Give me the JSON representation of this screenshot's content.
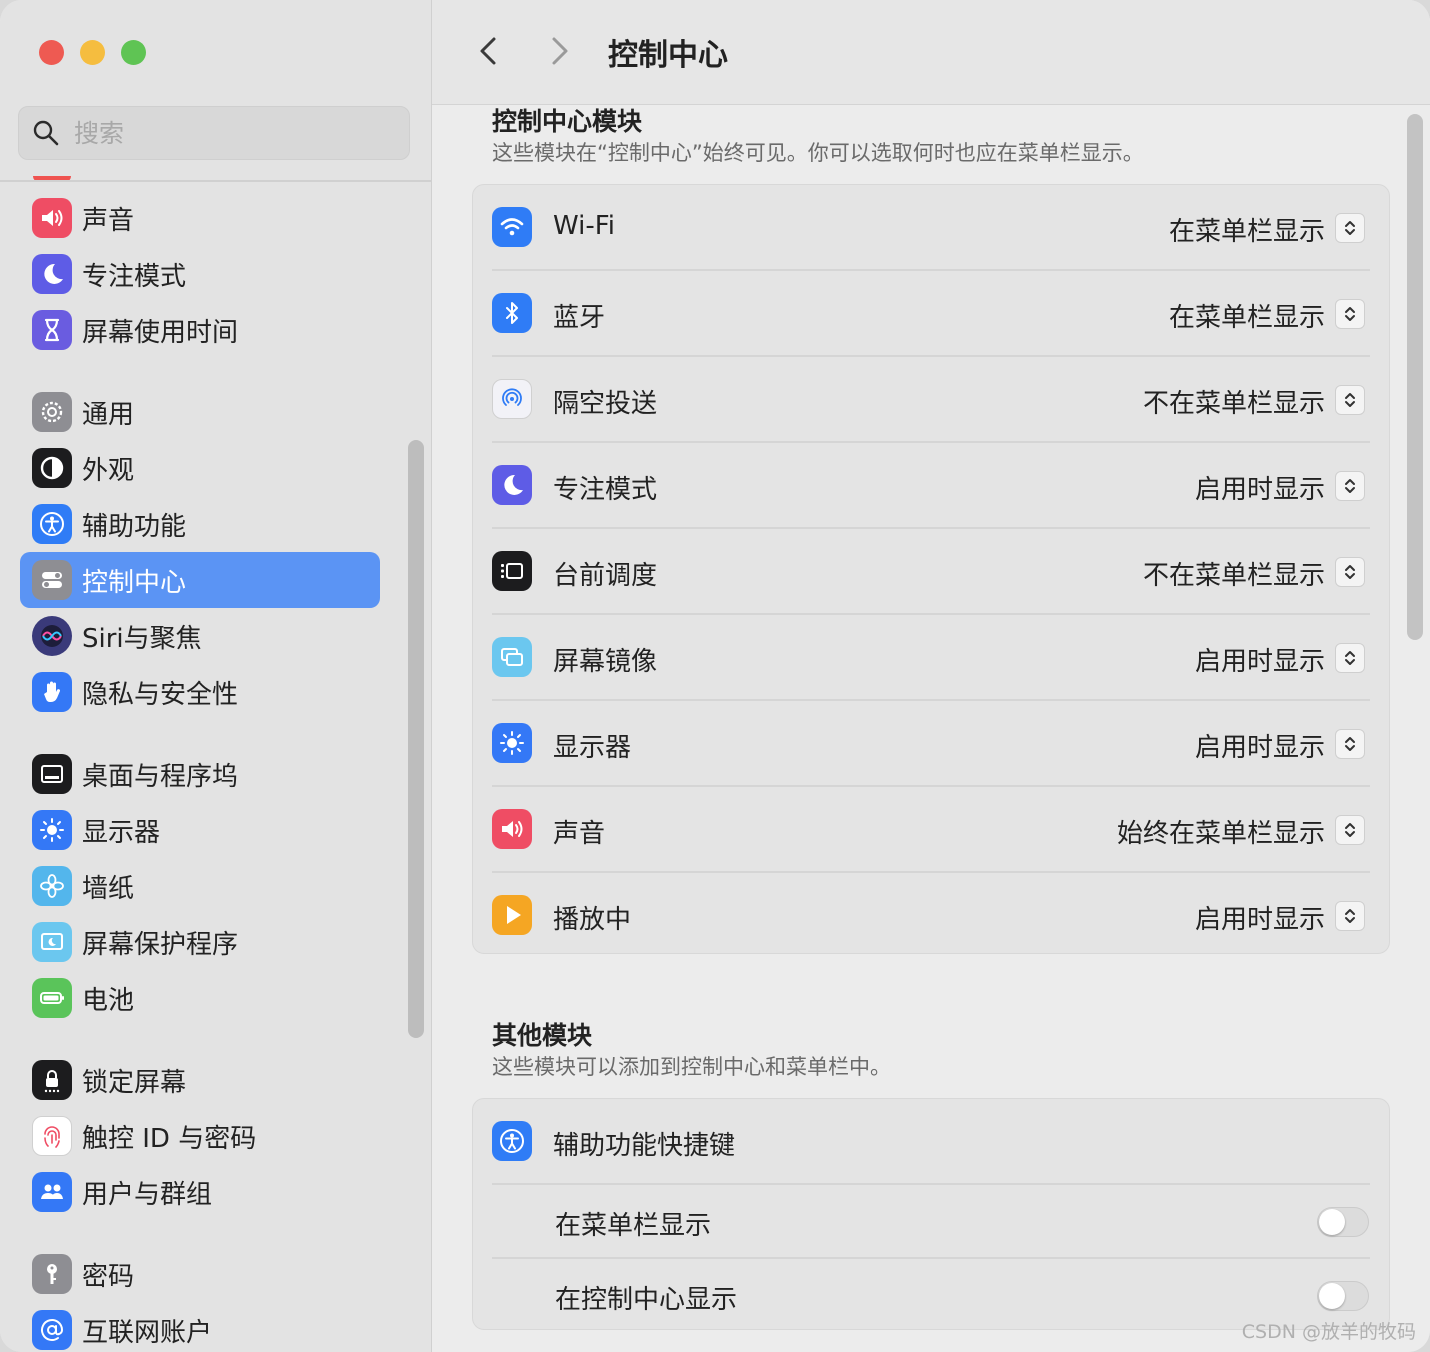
{
  "window": {
    "traffic_lights": {
      "close": "#ee5a52",
      "minimize": "#f5bd3f",
      "zoom": "#5fc454"
    }
  },
  "sidebar": {
    "search_placeholder": "搜索",
    "selected_color": "#5b94f4",
    "items": [
      {
        "label": "声音",
        "icon": "speaker-icon",
        "color": "#ef4d64"
      },
      {
        "label": "专注模式",
        "icon": "moon-icon",
        "color": "#5e5ce6"
      },
      {
        "label": "屏幕使用时间",
        "icon": "hourglass-icon",
        "color": "#6a5ce0"
      },
      {
        "label": "通用",
        "icon": "gear-icon",
        "color": "#8e8e93"
      },
      {
        "label": "外观",
        "icon": "appearance-icon",
        "color": "#1c1c1e"
      },
      {
        "label": "辅助功能",
        "icon": "accessibility-icon",
        "color": "#2f7cf6"
      },
      {
        "label": "控制中心",
        "icon": "toggles-icon",
        "color": "#8e8e93",
        "selected": true
      },
      {
        "label": "Siri与聚焦",
        "icon": "siri-icon",
        "color": "#3a3a7a"
      },
      {
        "label": "隐私与安全性",
        "icon": "hand-icon",
        "color": "#3478f6"
      },
      {
        "label": "桌面与程序坞",
        "icon": "dock-icon",
        "color": "#1c1c1e"
      },
      {
        "label": "显示器",
        "icon": "sun-icon",
        "color": "#3478f6"
      },
      {
        "label": "墙纸",
        "icon": "flower-icon",
        "color": "#53b6ec"
      },
      {
        "label": "屏幕保护程序",
        "icon": "screensaver-icon",
        "color": "#6bc7ef"
      },
      {
        "label": "电池",
        "icon": "battery-icon",
        "color": "#5ac45a"
      },
      {
        "label": "锁定屏幕",
        "icon": "lock-icon",
        "color": "#1c1c1e"
      },
      {
        "label": "触控 ID 与密码",
        "icon": "fingerprint-icon",
        "color": "#ffffff"
      },
      {
        "label": "用户与群组",
        "icon": "users-icon",
        "color": "#3478f6"
      },
      {
        "label": "密码",
        "icon": "key-icon",
        "color": "#8e8e93"
      },
      {
        "label": "互联网账户",
        "icon": "at-icon",
        "color": "#3478f6"
      }
    ]
  },
  "toolbar": {
    "title": "控制中心"
  },
  "modules": {
    "title": "控制中心模块",
    "description": "这些模块在“控制中心”始终可见。你可以选取何时也应在菜单栏显示。",
    "rows": [
      {
        "name": "Wi-Fi",
        "value": "在菜单栏显示",
        "icon": "wifi-icon",
        "color": "#2f7cf6"
      },
      {
        "name": "蓝牙",
        "value": "在菜单栏显示",
        "icon": "bluetooth-icon",
        "color": "#2f7cf6"
      },
      {
        "name": "隔空投送",
        "value": "不在菜单栏显示",
        "icon": "airdrop-icon",
        "color": "#f2f2f7"
      },
      {
        "name": "专注模式",
        "value": "启用时显示",
        "icon": "moon-icon",
        "color": "#5e5ce6"
      },
      {
        "name": "台前调度",
        "value": "不在菜单栏显示",
        "icon": "stage-manager-icon",
        "color": "#1c1c1e"
      },
      {
        "name": "屏幕镜像",
        "value": "启用时显示",
        "icon": "screen-mirror-icon",
        "color": "#6bc7ef"
      },
      {
        "name": "显示器",
        "value": "启用时显示",
        "icon": "sun-icon",
        "color": "#3478f6"
      },
      {
        "name": "声音",
        "value": "始终在菜单栏显示",
        "icon": "speaker-icon",
        "color": "#ef4d64"
      },
      {
        "name": "播放中",
        "value": "启用时显示",
        "icon": "play-icon",
        "color": "#f5a623"
      }
    ]
  },
  "other": {
    "title": "其他模块",
    "description": "这些模块可以添加到控制中心和菜单栏中。",
    "module_name": "辅助功能快捷键",
    "options": [
      {
        "label": "在菜单栏显示",
        "on": false
      },
      {
        "label": "在控制中心显示",
        "on": false
      }
    ]
  },
  "watermark": "CSDN @放羊的牧码"
}
